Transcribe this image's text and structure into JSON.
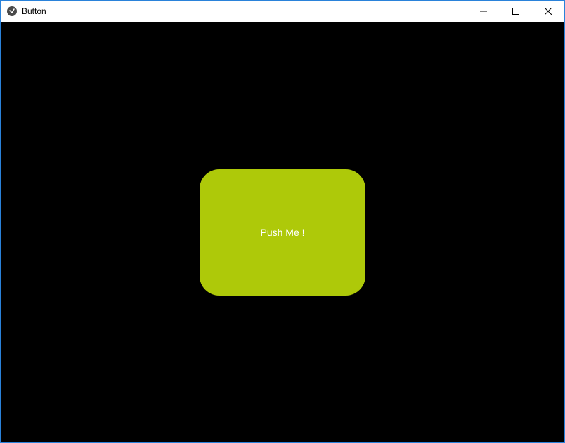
{
  "window": {
    "title": "Button"
  },
  "main": {
    "button_label": "Push Me !"
  }
}
